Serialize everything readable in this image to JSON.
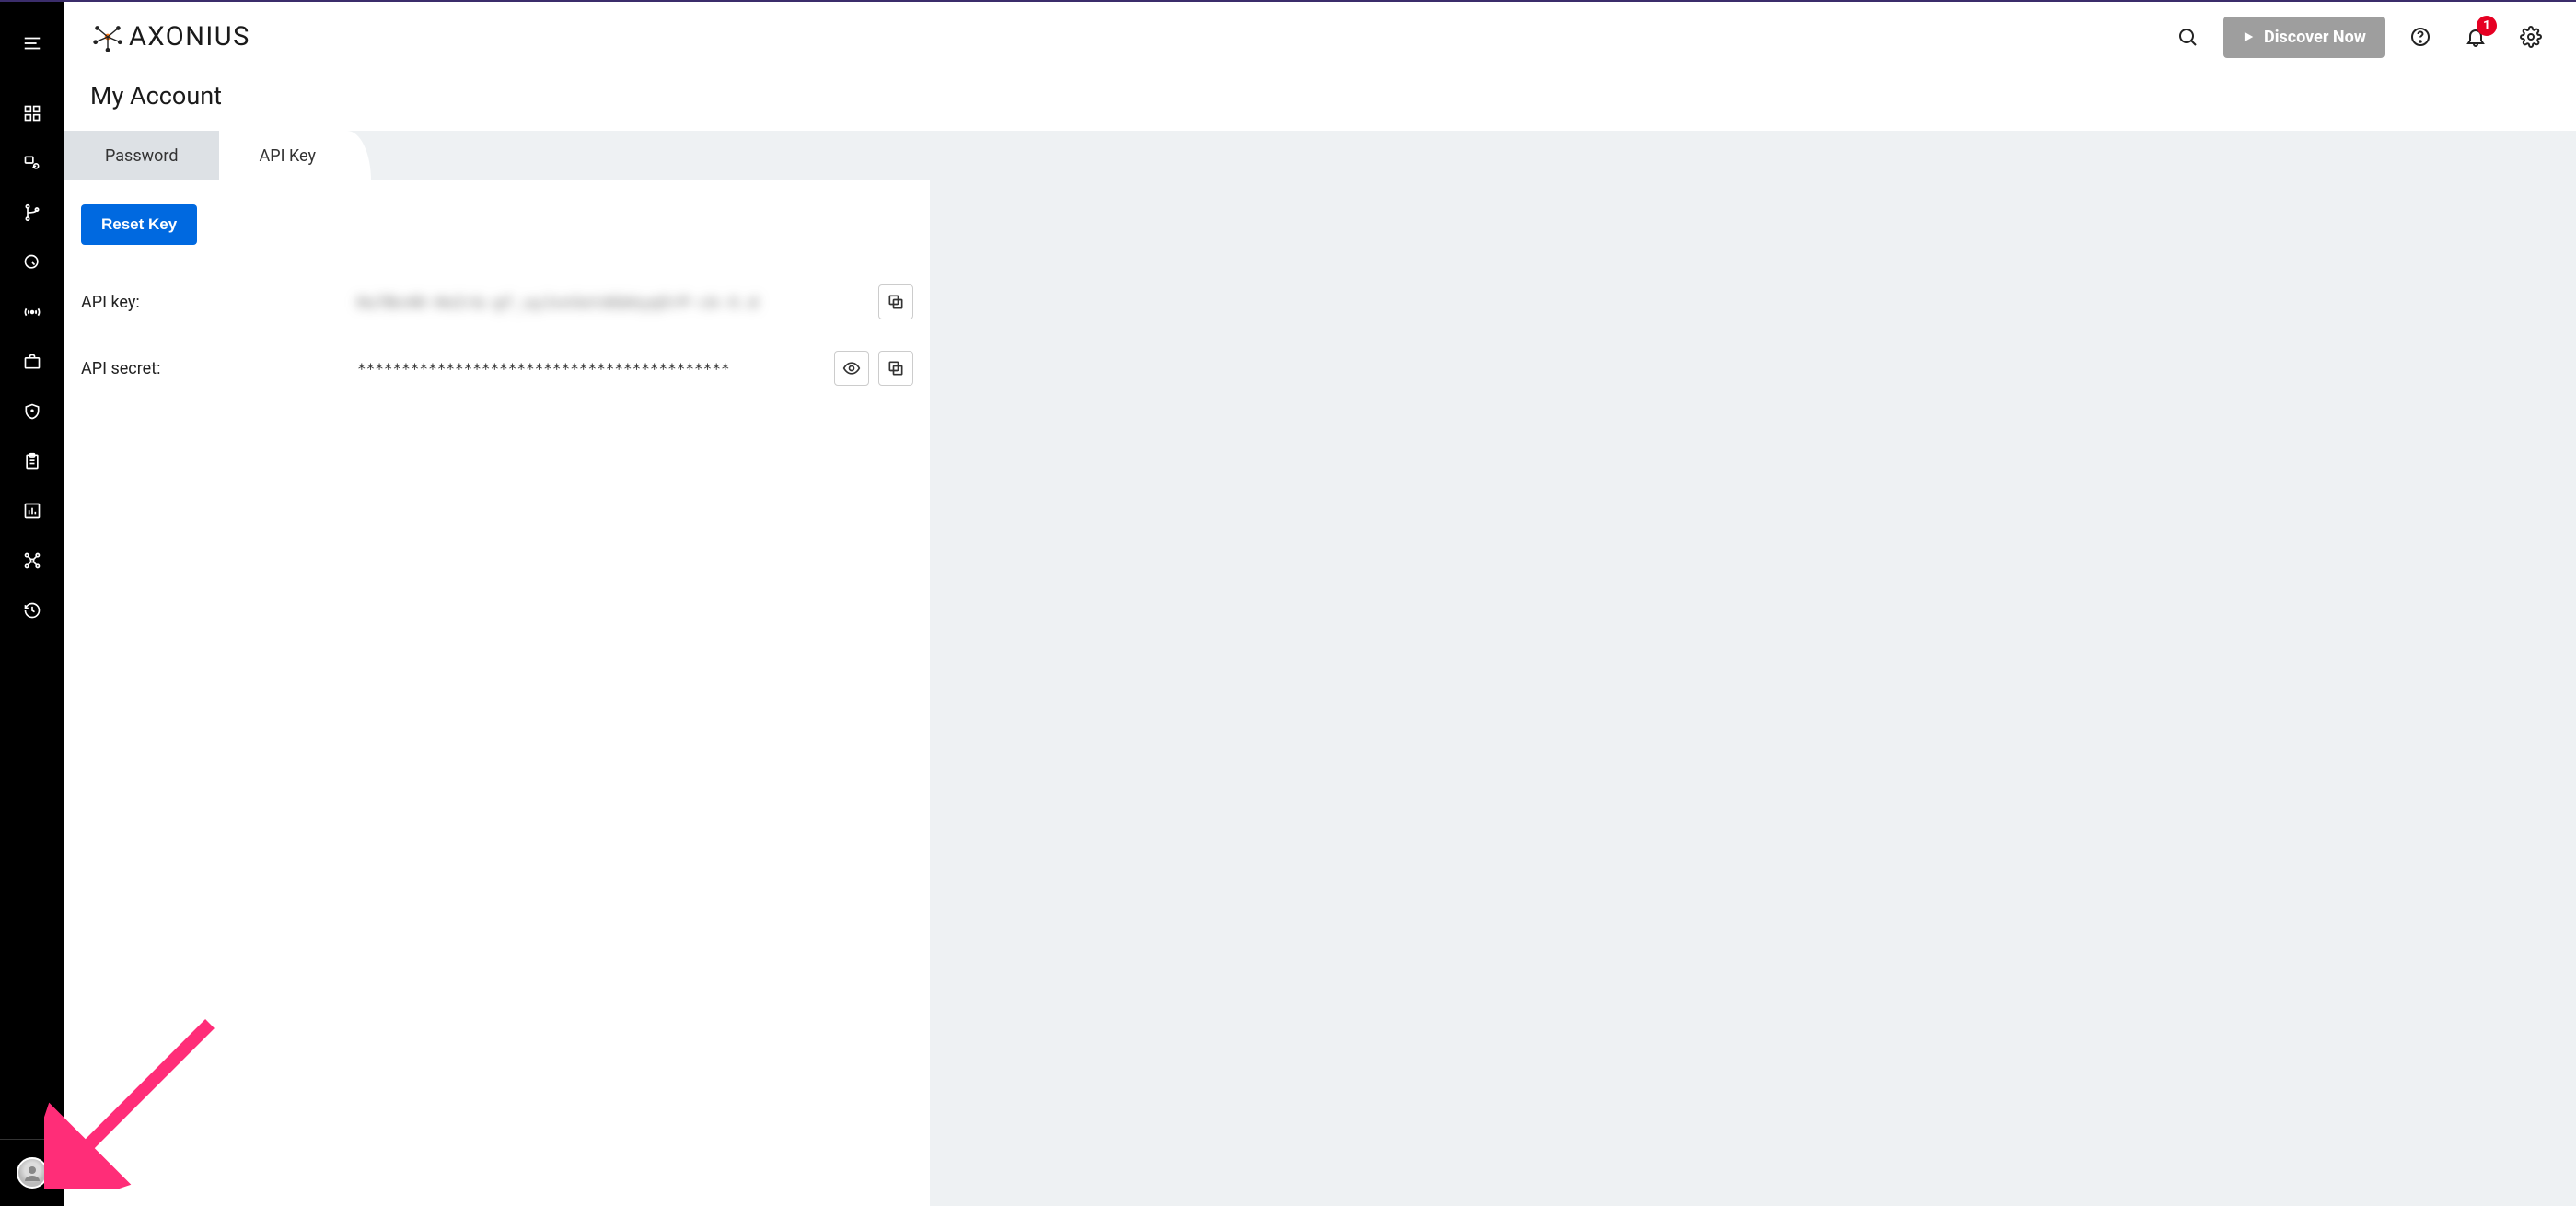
{
  "brand": {
    "name": "AXONIUS"
  },
  "topbar": {
    "discover_label": "Discover Now",
    "notification_count": "1"
  },
  "page": {
    "title": "My Account"
  },
  "tabs": [
    {
      "label": "Password",
      "active": false
    },
    {
      "label": "API Key",
      "active": true
    }
  ],
  "panel": {
    "reset_label": "Reset Key",
    "api_key_label": "API key:",
    "api_key_value": "Hu7Bv48-HoIr&-gf_uyJxnSetdGbkyq5rP-ck-X.d",
    "api_secret_label": "API secret:",
    "api_secret_value": "******************************************"
  }
}
